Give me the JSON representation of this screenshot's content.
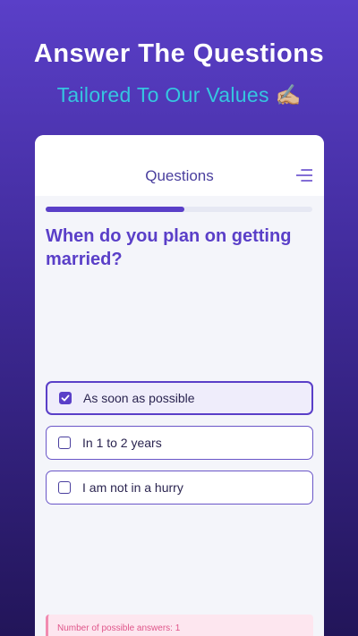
{
  "promo": {
    "headline": "Answer The Questions",
    "subline": "Tailored To Our Values ✍🏼"
  },
  "app": {
    "title": "Questions",
    "menu_icon": "menu-icon",
    "progress": 0.52,
    "question": "When do you plan on getting married?",
    "options": [
      {
        "label": "As soon as possible",
        "selected": true
      },
      {
        "label": "In 1 to 2 years",
        "selected": false
      },
      {
        "label": "I am not in a hurry",
        "selected": false
      }
    ],
    "hint": "Number of possible answers: 1"
  },
  "colors": {
    "accent": "#5a3fc8",
    "subline": "#35c6e0",
    "hint_text": "#e0558a"
  }
}
